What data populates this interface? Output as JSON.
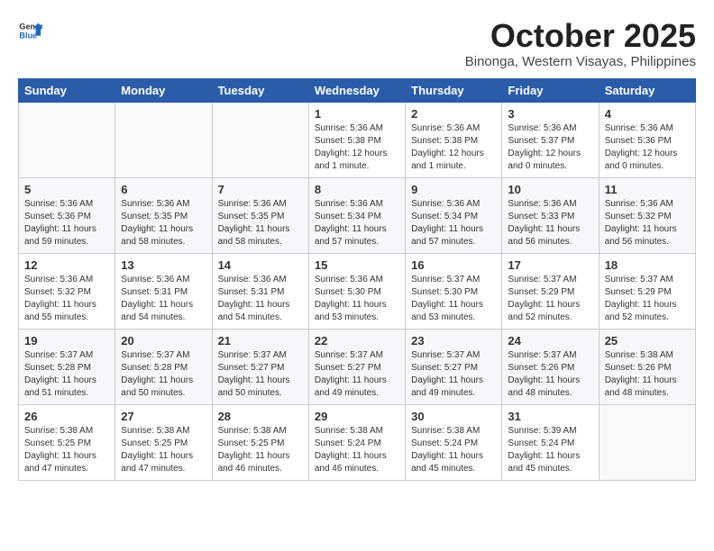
{
  "logo": {
    "general": "General",
    "blue": "Blue"
  },
  "title": {
    "month": "October 2025",
    "location": "Binonga, Western Visayas, Philippines"
  },
  "weekdays": [
    "Sunday",
    "Monday",
    "Tuesday",
    "Wednesday",
    "Thursday",
    "Friday",
    "Saturday"
  ],
  "weeks": [
    [
      {
        "day": "",
        "info": ""
      },
      {
        "day": "",
        "info": ""
      },
      {
        "day": "",
        "info": ""
      },
      {
        "day": "1",
        "info": "Sunrise: 5:36 AM\nSunset: 5:38 PM\nDaylight: 12 hours\nand 1 minute."
      },
      {
        "day": "2",
        "info": "Sunrise: 5:36 AM\nSunset: 5:38 PM\nDaylight: 12 hours\nand 1 minute."
      },
      {
        "day": "3",
        "info": "Sunrise: 5:36 AM\nSunset: 5:37 PM\nDaylight: 12 hours\nand 0 minutes."
      },
      {
        "day": "4",
        "info": "Sunrise: 5:36 AM\nSunset: 5:36 PM\nDaylight: 12 hours\nand 0 minutes."
      }
    ],
    [
      {
        "day": "5",
        "info": "Sunrise: 5:36 AM\nSunset: 5:36 PM\nDaylight: 11 hours\nand 59 minutes."
      },
      {
        "day": "6",
        "info": "Sunrise: 5:36 AM\nSunset: 5:35 PM\nDaylight: 11 hours\nand 58 minutes."
      },
      {
        "day": "7",
        "info": "Sunrise: 5:36 AM\nSunset: 5:35 PM\nDaylight: 11 hours\nand 58 minutes."
      },
      {
        "day": "8",
        "info": "Sunrise: 5:36 AM\nSunset: 5:34 PM\nDaylight: 11 hours\nand 57 minutes."
      },
      {
        "day": "9",
        "info": "Sunrise: 5:36 AM\nSunset: 5:34 PM\nDaylight: 11 hours\nand 57 minutes."
      },
      {
        "day": "10",
        "info": "Sunrise: 5:36 AM\nSunset: 5:33 PM\nDaylight: 11 hours\nand 56 minutes."
      },
      {
        "day": "11",
        "info": "Sunrise: 5:36 AM\nSunset: 5:32 PM\nDaylight: 11 hours\nand 56 minutes."
      }
    ],
    [
      {
        "day": "12",
        "info": "Sunrise: 5:36 AM\nSunset: 5:32 PM\nDaylight: 11 hours\nand 55 minutes."
      },
      {
        "day": "13",
        "info": "Sunrise: 5:36 AM\nSunset: 5:31 PM\nDaylight: 11 hours\nand 54 minutes."
      },
      {
        "day": "14",
        "info": "Sunrise: 5:36 AM\nSunset: 5:31 PM\nDaylight: 11 hours\nand 54 minutes."
      },
      {
        "day": "15",
        "info": "Sunrise: 5:36 AM\nSunset: 5:30 PM\nDaylight: 11 hours\nand 53 minutes."
      },
      {
        "day": "16",
        "info": "Sunrise: 5:37 AM\nSunset: 5:30 PM\nDaylight: 11 hours\nand 53 minutes."
      },
      {
        "day": "17",
        "info": "Sunrise: 5:37 AM\nSunset: 5:29 PM\nDaylight: 11 hours\nand 52 minutes."
      },
      {
        "day": "18",
        "info": "Sunrise: 5:37 AM\nSunset: 5:29 PM\nDaylight: 11 hours\nand 52 minutes."
      }
    ],
    [
      {
        "day": "19",
        "info": "Sunrise: 5:37 AM\nSunset: 5:28 PM\nDaylight: 11 hours\nand 51 minutes."
      },
      {
        "day": "20",
        "info": "Sunrise: 5:37 AM\nSunset: 5:28 PM\nDaylight: 11 hours\nand 50 minutes."
      },
      {
        "day": "21",
        "info": "Sunrise: 5:37 AM\nSunset: 5:27 PM\nDaylight: 11 hours\nand 50 minutes."
      },
      {
        "day": "22",
        "info": "Sunrise: 5:37 AM\nSunset: 5:27 PM\nDaylight: 11 hours\nand 49 minutes."
      },
      {
        "day": "23",
        "info": "Sunrise: 5:37 AM\nSunset: 5:27 PM\nDaylight: 11 hours\nand 49 minutes."
      },
      {
        "day": "24",
        "info": "Sunrise: 5:37 AM\nSunset: 5:26 PM\nDaylight: 11 hours\nand 48 minutes."
      },
      {
        "day": "25",
        "info": "Sunrise: 5:38 AM\nSunset: 5:26 PM\nDaylight: 11 hours\nand 48 minutes."
      }
    ],
    [
      {
        "day": "26",
        "info": "Sunrise: 5:38 AM\nSunset: 5:25 PM\nDaylight: 11 hours\nand 47 minutes."
      },
      {
        "day": "27",
        "info": "Sunrise: 5:38 AM\nSunset: 5:25 PM\nDaylight: 11 hours\nand 47 minutes."
      },
      {
        "day": "28",
        "info": "Sunrise: 5:38 AM\nSunset: 5:25 PM\nDaylight: 11 hours\nand 46 minutes."
      },
      {
        "day": "29",
        "info": "Sunrise: 5:38 AM\nSunset: 5:24 PM\nDaylight: 11 hours\nand 46 minutes."
      },
      {
        "day": "30",
        "info": "Sunrise: 5:38 AM\nSunset: 5:24 PM\nDaylight: 11 hours\nand 45 minutes."
      },
      {
        "day": "31",
        "info": "Sunrise: 5:39 AM\nSunset: 5:24 PM\nDaylight: 11 hours\nand 45 minutes."
      },
      {
        "day": "",
        "info": ""
      }
    ]
  ]
}
